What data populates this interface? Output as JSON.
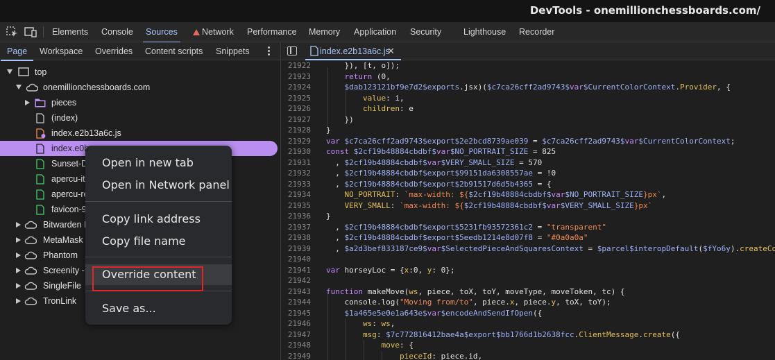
{
  "window": {
    "title": "DevTools - onemillionchessboards.com/"
  },
  "main_tabs": [
    "Elements",
    "Console",
    "Sources",
    "Network",
    "Performance",
    "Memory",
    "Application",
    "Security",
    "Lighthouse",
    "Recorder"
  ],
  "active_main_tab": "Sources",
  "sources_tabs": [
    "Page",
    "Workspace",
    "Overrides",
    "Content scripts",
    "Snippets"
  ],
  "active_sources_tab": "Page",
  "tree": [
    {
      "label": "top",
      "icon": "frame-icon"
    },
    {
      "label": "onemillionchessboards.com",
      "icon": "cloud-icon"
    },
    {
      "label": "pieces",
      "icon": "folder-icon"
    },
    {
      "label": "(index)",
      "icon": "document-icon"
    },
    {
      "label": "index.e2b13a6c.js",
      "icon": "js-file-icon"
    },
    {
      "label": "index.e0b",
      "icon": "document-icon"
    },
    {
      "label": "Sunset-D",
      "icon": "font-file-icon"
    },
    {
      "label": "apercu-it",
      "icon": "font-file-icon"
    },
    {
      "label": "apercu-re",
      "icon": "font-file-icon"
    },
    {
      "label": "favicon-9",
      "icon": "image-file-icon"
    },
    {
      "label": "Bitwarden F",
      "icon": "cloud-icon"
    },
    {
      "label": "MetaMask",
      "icon": "cloud-icon"
    },
    {
      "label": "Phantom",
      "icon": "cloud-icon"
    },
    {
      "label": "Screenity - ",
      "icon": "cloud-icon"
    },
    {
      "label": "SingleFile",
      "icon": "cloud-icon"
    },
    {
      "label": "TronLink",
      "icon": "cloud-icon"
    }
  ],
  "editor": {
    "open_file": "index.e2b13a6c.js",
    "close_glyph": "✕",
    "lines": [
      {
        "n": "21922",
        "t": "    }), [t, o]);"
      },
      {
        "n": "21923",
        "t": "    return (0,"
      },
      {
        "n": "21924",
        "t": "    $dab123121bf9e7d2$exports.jsx)($c7ca26cff2ad9743$var$CurrentColorContext.Provider, {"
      },
      {
        "n": "21925",
        "t": "        value: i,"
      },
      {
        "n": "21926",
        "t": "        children: e"
      },
      {
        "n": "21927",
        "t": "    })"
      },
      {
        "n": "21928",
        "t": "}"
      },
      {
        "n": "21929",
        "t": "var $c7ca26cff2ad9743$export$2e2bcd8739ae039 = $c7ca26cff2ad9743$var$CurrentColorContext;"
      },
      {
        "n": "21930",
        "t": "const $2cf19b48884cbdbf$var$NO_PORTRAIT_SIZE = 825"
      },
      {
        "n": "21931",
        "t": "  , $2cf19b48884cbdbf$var$VERY_SMALL_SIZE = 570"
      },
      {
        "n": "21932",
        "t": "  , $2cf19b48884cbdbf$export$99151da6308557ae = !0"
      },
      {
        "n": "21933",
        "t": "  , $2cf19b48884cbdbf$export$2b91517d6d5b4365 = {"
      },
      {
        "n": "21934",
        "t": "    NO_PORTRAIT: `max-width: ${$2cf19b48884cbdbf$var$NO_PORTRAIT_SIZE}px`,"
      },
      {
        "n": "21935",
        "t": "    VERY_SMALL: `max-width: ${$2cf19b48884cbdbf$var$VERY_SMALL_SIZE}px`"
      },
      {
        "n": "21936",
        "t": "}"
      },
      {
        "n": "21937",
        "t": "  , $2cf19b48884cbdbf$export$5231fb93572361c2 = \"transparent\""
      },
      {
        "n": "21938",
        "t": "  , $2cf19b48884cbdbf$export$5eedb1214e8d07f8 = \"#0a0a0a\""
      },
      {
        "n": "21939",
        "t": "  , $a2d3bef833187ce9$var$SelectedPieceAndSquaresContext = $parcel$interopDefault($fYo6y).createCo"
      },
      {
        "n": "21940",
        "t": ""
      },
      {
        "n": "21941",
        "t": "var horseyLoc = {x:0, y: 0};"
      },
      {
        "n": "21942",
        "t": ""
      },
      {
        "n": "21943",
        "t": "function makeMove(ws, piece, toX, toY, moveType, moveToken, tc) {"
      },
      {
        "n": "21944",
        "t": "    console.log(\"Moving from/to\", piece.x, piece.y, toX, toY);"
      },
      {
        "n": "21945",
        "t": "    $1a465e5e0e1a643e$var$encodeAndSendIfOpen({"
      },
      {
        "n": "21946",
        "t": "        ws: ws,"
      },
      {
        "n": "21947",
        "t": "        msg: $7c772816412bae4a$export$bb1766d1b2638fcc.ClientMessage.create({"
      },
      {
        "n": "21948",
        "t": "            move: {"
      },
      {
        "n": "21949",
        "t": "                pieceId: piece.id,"
      }
    ]
  },
  "context_menu": {
    "items": [
      "Open in new tab",
      "Open in Network panel",
      "Copy link address",
      "Copy file name",
      "Override content",
      "Save as..."
    ],
    "highlighted": "Override content"
  },
  "colors": {
    "accent": "#a8c7fa",
    "selection": "#b98ef0",
    "annotation_box": "#e0262a",
    "syntax_keyword": "#c58af9",
    "syntax_string": "#f28b54",
    "syntax_property": "#e3c15b",
    "syntax_variable": "#9fb2f7"
  }
}
